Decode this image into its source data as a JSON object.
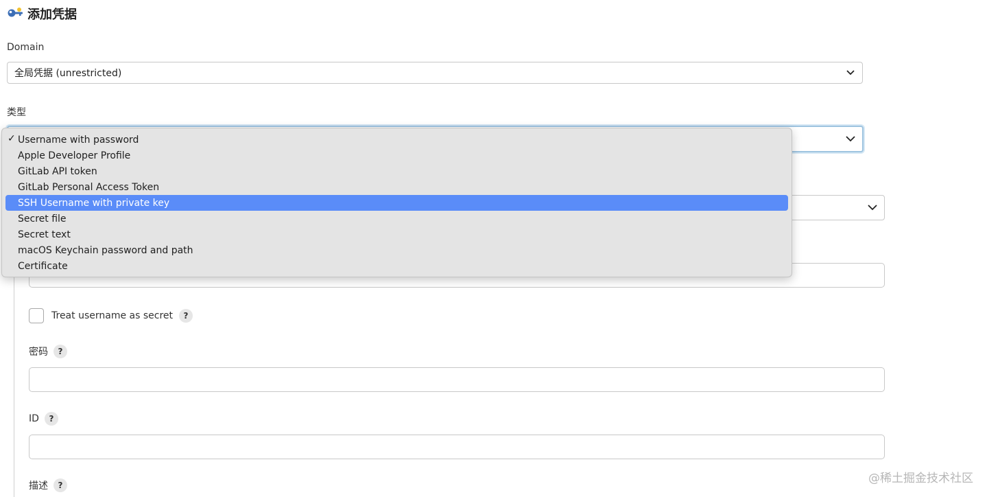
{
  "page": {
    "title": "添加凭据",
    "title_icon": "key-icon"
  },
  "domain": {
    "label": "Domain",
    "selected": "全局凭据 (unrestricted)"
  },
  "kind": {
    "label": "类型",
    "selected": "Username with password",
    "options": [
      "Username with password",
      "Apple Developer Profile",
      "GitLab API token",
      "GitLab Personal Access Token",
      "SSH Username with private key",
      "Secret file",
      "Secret text",
      "macOS Keychain password and path",
      "Certificate"
    ],
    "highlighted": "SSH Username with private key",
    "check_mark": "✓"
  },
  "form": {
    "treat_username_secret": "Treat username as secret",
    "password_label": "密码",
    "id_label": "ID",
    "description_label": "描述",
    "help_glyph": "?"
  },
  "watermark": "@稀土掘金技术社区",
  "colors": {
    "highlight": "#5a8cf8",
    "focus_ring": "#9ec4e0"
  }
}
